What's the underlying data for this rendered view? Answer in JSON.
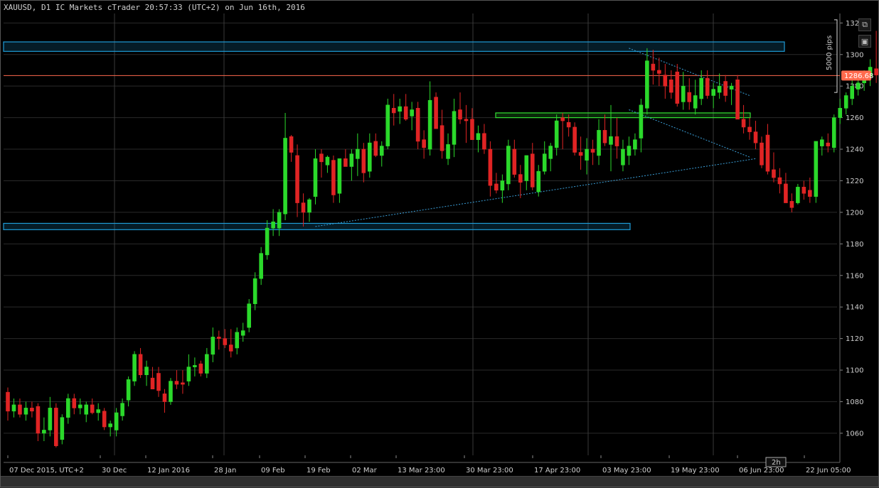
{
  "header": {
    "title": "XAUUSD, D1 IC Markets cTrader 20:57:33 (UTC+2) on Jun 16th, 2016"
  },
  "toolbar": {
    "popout_icon": "⧉",
    "camera_icon": "▣"
  },
  "price_label": {
    "value": "1286.68"
  },
  "measure": {
    "pips_label": "5000 pips"
  },
  "timeframe_badge": {
    "label": "2h"
  },
  "colors": {
    "bull": "#2bd92b",
    "bear": "#e02424",
    "level_line": "#ff6a4d",
    "zone_blue": "#1e9bd7",
    "zone_green": "#33e033",
    "trend": "#3a9fd8",
    "grid": "#2a2a2a"
  },
  "chart_data": {
    "type": "candlestick",
    "title": "XAUUSD, D1 IC Markets cTrader 20:57:33 (UTC+2) on Jun 16th, 2016",
    "ylim": [
      1046,
      1326
    ],
    "y_ticks": [
      1060,
      1080,
      1100,
      1120,
      1140,
      1160,
      1180,
      1200,
      1220,
      1240,
      1260,
      1280,
      1300,
      1320
    ],
    "x_labels": [
      "07 Dec 2015, UTC+2",
      "30 Dec",
      "12 Jan 2016",
      "28 Jan",
      "09 Feb",
      "19 Feb",
      "02 Mar",
      "13 Mar 23:00",
      "30 Mar 23:00",
      "17 Apr 23:00",
      "03 May 23:00",
      "19 May 23:00",
      "06 Jun 23:00",
      "22 Jun 05:00"
    ],
    "current_price": 1286.68,
    "candles": [
      {
        "o": 1086,
        "h": 1089,
        "l": 1068,
        "c": 1074
      },
      {
        "o": 1074,
        "h": 1082,
        "l": 1070,
        "c": 1078
      },
      {
        "o": 1078,
        "h": 1082,
        "l": 1070,
        "c": 1072
      },
      {
        "o": 1072,
        "h": 1080,
        "l": 1068,
        "c": 1076
      },
      {
        "o": 1076,
        "h": 1080,
        "l": 1070,
        "c": 1074
      },
      {
        "o": 1077,
        "h": 1079,
        "l": 1055,
        "c": 1060
      },
      {
        "o": 1060,
        "h": 1070,
        "l": 1055,
        "c": 1062
      },
      {
        "o": 1062,
        "h": 1083,
        "l": 1058,
        "c": 1076
      },
      {
        "o": 1076,
        "h": 1079,
        "l": 1051,
        "c": 1052
      },
      {
        "o": 1056,
        "h": 1072,
        "l": 1053,
        "c": 1070
      },
      {
        "o": 1070,
        "h": 1085,
        "l": 1066,
        "c": 1082
      },
      {
        "o": 1082,
        "h": 1085,
        "l": 1072,
        "c": 1076
      },
      {
        "o": 1076,
        "h": 1082,
        "l": 1072,
        "c": 1078
      },
      {
        "o": 1072,
        "h": 1080,
        "l": 1067,
        "c": 1078
      },
      {
        "o": 1078,
        "h": 1082,
        "l": 1072,
        "c": 1073
      },
      {
        "o": 1073,
        "h": 1079,
        "l": 1068,
        "c": 1075
      },
      {
        "o": 1074,
        "h": 1076,
        "l": 1062,
        "c": 1064
      },
      {
        "o": 1064,
        "h": 1068,
        "l": 1058,
        "c": 1066
      },
      {
        "o": 1062,
        "h": 1076,
        "l": 1058,
        "c": 1073
      },
      {
        "o": 1071,
        "h": 1082,
        "l": 1068,
        "c": 1079
      },
      {
        "o": 1081,
        "h": 1096,
        "l": 1077,
        "c": 1094
      },
      {
        "o": 1093,
        "h": 1112,
        "l": 1090,
        "c": 1110
      },
      {
        "o": 1110,
        "h": 1114,
        "l": 1095,
        "c": 1097
      },
      {
        "o": 1097,
        "h": 1106,
        "l": 1090,
        "c": 1102
      },
      {
        "o": 1095,
        "h": 1102,
        "l": 1088,
        "c": 1088
      },
      {
        "o": 1098,
        "h": 1102,
        "l": 1083,
        "c": 1087
      },
      {
        "o": 1085,
        "h": 1088,
        "l": 1073,
        "c": 1080
      },
      {
        "o": 1080,
        "h": 1095,
        "l": 1078,
        "c": 1093
      },
      {
        "o": 1093,
        "h": 1100,
        "l": 1088,
        "c": 1091
      },
      {
        "o": 1092,
        "h": 1100,
        "l": 1085,
        "c": 1091
      },
      {
        "o": 1093,
        "h": 1110,
        "l": 1090,
        "c": 1102
      },
      {
        "o": 1102,
        "h": 1108,
        "l": 1096,
        "c": 1103
      },
      {
        "o": 1104,
        "h": 1106,
        "l": 1096,
        "c": 1098
      },
      {
        "o": 1098,
        "h": 1114,
        "l": 1095,
        "c": 1110
      },
      {
        "o": 1110,
        "h": 1127,
        "l": 1105,
        "c": 1121
      },
      {
        "o": 1121,
        "h": 1125,
        "l": 1113,
        "c": 1120
      },
      {
        "o": 1120,
        "h": 1126,
        "l": 1114,
        "c": 1116
      },
      {
        "o": 1116,
        "h": 1126,
        "l": 1108,
        "c": 1112
      },
      {
        "o": 1114,
        "h": 1127,
        "l": 1110,
        "c": 1124
      },
      {
        "o": 1122,
        "h": 1130,
        "l": 1118,
        "c": 1125
      },
      {
        "o": 1127,
        "h": 1145,
        "l": 1124,
        "c": 1142
      },
      {
        "o": 1142,
        "h": 1162,
        "l": 1138,
        "c": 1158
      },
      {
        "o": 1158,
        "h": 1178,
        "l": 1154,
        "c": 1174
      },
      {
        "o": 1173,
        "h": 1195,
        "l": 1170,
        "c": 1190
      },
      {
        "o": 1190,
        "h": 1202,
        "l": 1185,
        "c": 1194
      },
      {
        "o": 1190,
        "h": 1202,
        "l": 1185,
        "c": 1200
      },
      {
        "o": 1199,
        "h": 1263,
        "l": 1195,
        "c": 1247
      },
      {
        "o": 1248,
        "h": 1249,
        "l": 1232,
        "c": 1238
      },
      {
        "o": 1236,
        "h": 1243,
        "l": 1197,
        "c": 1206
      },
      {
        "o": 1206,
        "h": 1212,
        "l": 1191,
        "c": 1200
      },
      {
        "o": 1200,
        "h": 1209,
        "l": 1194,
        "c": 1208
      },
      {
        "o": 1210,
        "h": 1240,
        "l": 1205,
        "c": 1234
      },
      {
        "o": 1237,
        "h": 1240,
        "l": 1222,
        "c": 1232
      },
      {
        "o": 1230,
        "h": 1236,
        "l": 1225,
        "c": 1235
      },
      {
        "o": 1233,
        "h": 1236,
        "l": 1206,
        "c": 1211
      },
      {
        "o": 1212,
        "h": 1234,
        "l": 1206,
        "c": 1234
      },
      {
        "o": 1234,
        "h": 1240,
        "l": 1229,
        "c": 1229
      },
      {
        "o": 1229,
        "h": 1240,
        "l": 1220,
        "c": 1237
      },
      {
        "o": 1234,
        "h": 1250,
        "l": 1223,
        "c": 1240
      },
      {
        "o": 1240,
        "h": 1244,
        "l": 1219,
        "c": 1225
      },
      {
        "o": 1226,
        "h": 1250,
        "l": 1222,
        "c": 1244
      },
      {
        "o": 1245,
        "h": 1250,
        "l": 1235,
        "c": 1236
      },
      {
        "o": 1236,
        "h": 1245,
        "l": 1229,
        "c": 1242
      },
      {
        "o": 1242,
        "h": 1272,
        "l": 1240,
        "c": 1268
      },
      {
        "o": 1266,
        "h": 1275,
        "l": 1255,
        "c": 1263
      },
      {
        "o": 1264,
        "h": 1272,
        "l": 1256,
        "c": 1267
      },
      {
        "o": 1267,
        "h": 1275,
        "l": 1258,
        "c": 1259
      },
      {
        "o": 1261,
        "h": 1270,
        "l": 1252,
        "c": 1265
      },
      {
        "o": 1266,
        "h": 1270,
        "l": 1240,
        "c": 1245
      },
      {
        "o": 1246,
        "h": 1252,
        "l": 1234,
        "c": 1241
      },
      {
        "o": 1240,
        "h": 1283,
        "l": 1236,
        "c": 1271
      },
      {
        "o": 1273,
        "h": 1276,
        "l": 1253,
        "c": 1253
      },
      {
        "o": 1255,
        "h": 1265,
        "l": 1234,
        "c": 1239
      },
      {
        "o": 1234,
        "h": 1250,
        "l": 1230,
        "c": 1243
      },
      {
        "o": 1243,
        "h": 1272,
        "l": 1235,
        "c": 1264
      },
      {
        "o": 1265,
        "h": 1276,
        "l": 1256,
        "c": 1259
      },
      {
        "o": 1259,
        "h": 1268,
        "l": 1244,
        "c": 1258
      },
      {
        "o": 1259,
        "h": 1266,
        "l": 1249,
        "c": 1246
      },
      {
        "o": 1246,
        "h": 1255,
        "l": 1238,
        "c": 1250
      },
      {
        "o": 1250,
        "h": 1256,
        "l": 1237,
        "c": 1240
      },
      {
        "o": 1240,
        "h": 1245,
        "l": 1210,
        "c": 1217
      },
      {
        "o": 1218,
        "h": 1225,
        "l": 1212,
        "c": 1214
      },
      {
        "o": 1214,
        "h": 1224,
        "l": 1206,
        "c": 1220
      },
      {
        "o": 1218,
        "h": 1246,
        "l": 1214,
        "c": 1242
      },
      {
        "o": 1240,
        "h": 1246,
        "l": 1222,
        "c": 1224
      },
      {
        "o": 1224,
        "h": 1230,
        "l": 1209,
        "c": 1219
      },
      {
        "o": 1220,
        "h": 1236,
        "l": 1214,
        "c": 1236
      },
      {
        "o": 1237,
        "h": 1244,
        "l": 1214,
        "c": 1216
      },
      {
        "o": 1213,
        "h": 1230,
        "l": 1210,
        "c": 1226
      },
      {
        "o": 1226,
        "h": 1245,
        "l": 1224,
        "c": 1237
      },
      {
        "o": 1234,
        "h": 1244,
        "l": 1226,
        "c": 1242
      },
      {
        "o": 1241,
        "h": 1262,
        "l": 1236,
        "c": 1258
      },
      {
        "o": 1260,
        "h": 1263,
        "l": 1240,
        "c": 1258
      },
      {
        "o": 1257,
        "h": 1262,
        "l": 1248,
        "c": 1254
      },
      {
        "o": 1254,
        "h": 1257,
        "l": 1236,
        "c": 1238
      },
      {
        "o": 1238,
        "h": 1248,
        "l": 1227,
        "c": 1236
      },
      {
        "o": 1233,
        "h": 1247,
        "l": 1224,
        "c": 1240
      },
      {
        "o": 1240,
        "h": 1246,
        "l": 1230,
        "c": 1238
      },
      {
        "o": 1236,
        "h": 1259,
        "l": 1230,
        "c": 1252
      },
      {
        "o": 1252,
        "h": 1262,
        "l": 1242,
        "c": 1244
      },
      {
        "o": 1243,
        "h": 1268,
        "l": 1226,
        "c": 1248
      },
      {
        "o": 1248,
        "h": 1260,
        "l": 1234,
        "c": 1242
      },
      {
        "o": 1230,
        "h": 1246,
        "l": 1226,
        "c": 1240
      },
      {
        "o": 1236,
        "h": 1248,
        "l": 1230,
        "c": 1242
      },
      {
        "o": 1240,
        "h": 1250,
        "l": 1236,
        "c": 1246
      },
      {
        "o": 1247,
        "h": 1272,
        "l": 1238,
        "c": 1268
      },
      {
        "o": 1266,
        "h": 1304,
        "l": 1262,
        "c": 1296
      },
      {
        "o": 1294,
        "h": 1303,
        "l": 1281,
        "c": 1290
      },
      {
        "o": 1290,
        "h": 1298,
        "l": 1280,
        "c": 1288
      },
      {
        "o": 1287,
        "h": 1294,
        "l": 1272,
        "c": 1280
      },
      {
        "o": 1284,
        "h": 1290,
        "l": 1272,
        "c": 1276
      },
      {
        "o": 1289,
        "h": 1294,
        "l": 1267,
        "c": 1269
      },
      {
        "o": 1270,
        "h": 1289,
        "l": 1265,
        "c": 1280
      },
      {
        "o": 1276,
        "h": 1285,
        "l": 1265,
        "c": 1270
      },
      {
        "o": 1266,
        "h": 1284,
        "l": 1262,
        "c": 1274
      },
      {
        "o": 1272,
        "h": 1290,
        "l": 1268,
        "c": 1285
      },
      {
        "o": 1285,
        "h": 1290,
        "l": 1272,
        "c": 1274
      },
      {
        "o": 1274,
        "h": 1282,
        "l": 1266,
        "c": 1278
      },
      {
        "o": 1276,
        "h": 1288,
        "l": 1272,
        "c": 1280
      },
      {
        "o": 1283,
        "h": 1287,
        "l": 1270,
        "c": 1274
      },
      {
        "o": 1278,
        "h": 1282,
        "l": 1268,
        "c": 1280
      },
      {
        "o": 1284,
        "h": 1287,
        "l": 1259,
        "c": 1259
      },
      {
        "o": 1259,
        "h": 1268,
        "l": 1250,
        "c": 1254
      },
      {
        "o": 1254,
        "h": 1260,
        "l": 1246,
        "c": 1251
      },
      {
        "o": 1251,
        "h": 1258,
        "l": 1240,
        "c": 1244
      },
      {
        "o": 1244,
        "h": 1248,
        "l": 1228,
        "c": 1230
      },
      {
        "o": 1249,
        "h": 1256,
        "l": 1224,
        "c": 1226
      },
      {
        "o": 1227,
        "h": 1238,
        "l": 1219,
        "c": 1222
      },
      {
        "o": 1222,
        "h": 1228,
        "l": 1212,
        "c": 1218
      },
      {
        "o": 1218,
        "h": 1225,
        "l": 1206,
        "c": 1206
      },
      {
        "o": 1207,
        "h": 1212,
        "l": 1200,
        "c": 1203
      },
      {
        "o": 1206,
        "h": 1218,
        "l": 1205,
        "c": 1216
      },
      {
        "o": 1216,
        "h": 1220,
        "l": 1208,
        "c": 1212
      },
      {
        "o": 1214,
        "h": 1222,
        "l": 1206,
        "c": 1210
      },
      {
        "o": 1210,
        "h": 1242,
        "l": 1206,
        "c": 1245
      },
      {
        "o": 1242,
        "h": 1248,
        "l": 1236,
        "c": 1246
      },
      {
        "o": 1244,
        "h": 1250,
        "l": 1238,
        "c": 1242
      },
      {
        "o": 1241,
        "h": 1262,
        "l": 1238,
        "c": 1260
      },
      {
        "o": 1260,
        "h": 1272,
        "l": 1256,
        "c": 1266
      },
      {
        "o": 1266,
        "h": 1276,
        "l": 1262,
        "c": 1274
      },
      {
        "o": 1272,
        "h": 1285,
        "l": 1268,
        "c": 1280
      },
      {
        "o": 1278,
        "h": 1288,
        "l": 1274,
        "c": 1282
      },
      {
        "o": 1282,
        "h": 1290,
        "l": 1277,
        "c": 1286
      },
      {
        "o": 1286,
        "h": 1297,
        "l": 1280,
        "c": 1292
      },
      {
        "o": 1291,
        "h": 1315,
        "l": 1282,
        "c": 1287
      }
    ],
    "zones": [
      {
        "color": "blue",
        "y1": 1302,
        "y2": 1308
      },
      {
        "color": "green",
        "y1": 1260,
        "y2": 1263
      },
      {
        "color": "blue",
        "y1": 1189,
        "y2": 1193
      }
    ],
    "trendlines": [
      {
        "from": {
          "index": 51,
          "price": 1191
        },
        "to": {
          "index": 124,
          "price": 1234
        }
      },
      {
        "from": {
          "index": 103,
          "price": 1304
        },
        "to": {
          "index": 123,
          "price": 1274
        }
      },
      {
        "from": {
          "index": 103,
          "price": 1265
        },
        "to": {
          "index": 123,
          "price": 1235
        }
      }
    ]
  }
}
